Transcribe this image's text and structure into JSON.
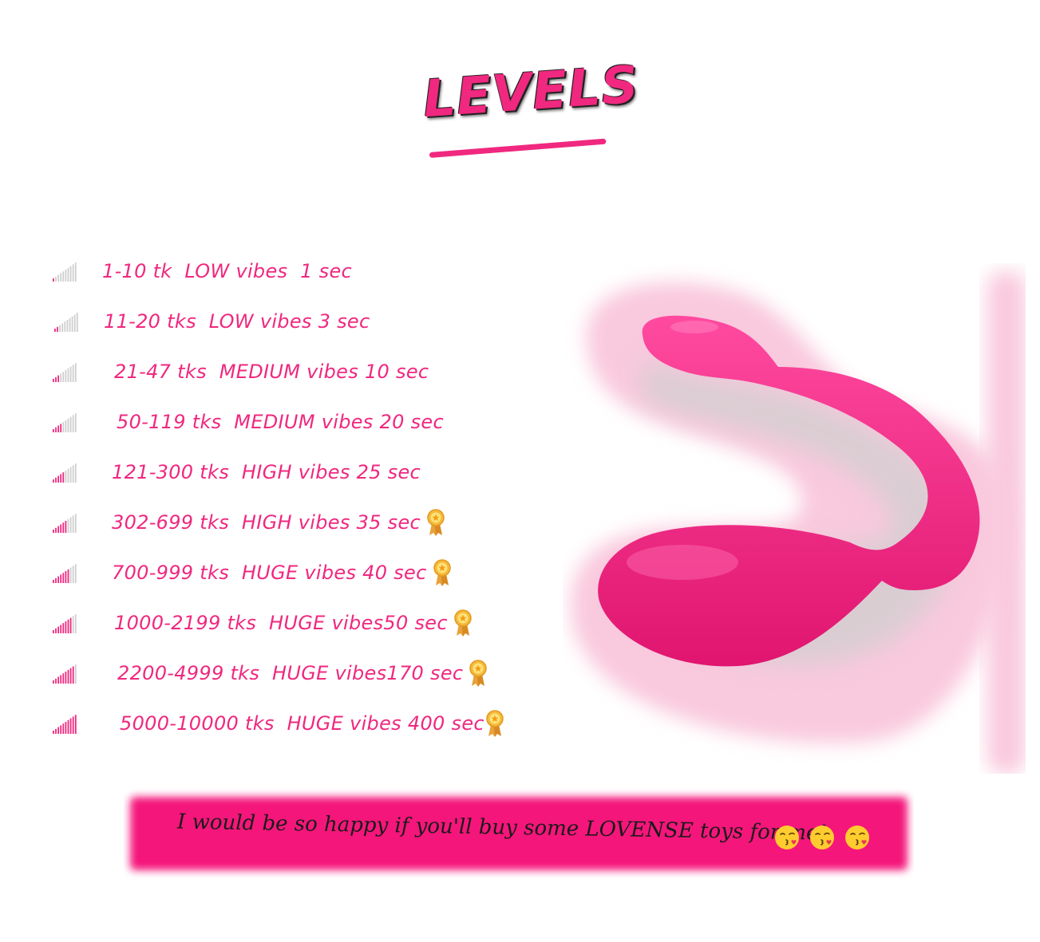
{
  "header": {
    "title": "LEVELS"
  },
  "levels": [
    {
      "text": "1-10 tk  LOW vibes  1 sec",
      "strength": 0.1,
      "medal": false
    },
    {
      "text": "11-20 tks  LOW vibes 3 sec",
      "strength": 0.2,
      "medal": false
    },
    {
      "text": "21-47 tks  MEDIUM vibes 10 sec",
      "strength": 0.3,
      "medal": false
    },
    {
      "text": "50-119 tks  MEDIUM vibes 20 sec",
      "strength": 0.4,
      "medal": false
    },
    {
      "text": "121-300 tks  HIGH vibes 25 sec",
      "strength": 0.5,
      "medal": false
    },
    {
      "text": "302-699 tks  HIGH vibes 35 sec",
      "strength": 0.6,
      "medal": true
    },
    {
      "text": "700-999 tks  HUGE vibes 40 sec",
      "strength": 0.7,
      "medal": true
    },
    {
      "text": "1000-2199 tks  HUGE vibes50 sec",
      "strength": 0.8,
      "medal": true
    },
    {
      "text": "2200-4999 tks  HUGE vibes170 sec",
      "strength": 0.9,
      "medal": true
    },
    {
      "text": "5000-10000 tks  HUGE vibes 400 sec",
      "strength": 1.0,
      "medal": true
    }
  ],
  "banner": {
    "text": "I would be so happy if you'll buy some LOVENSE toys for me!"
  },
  "emojis": [
    "kissing-face-icon",
    "kissing-face-icon",
    "kissing-face-icon"
  ],
  "colors": {
    "accent": "#f0287f",
    "bar_inactive": "#cfcfcf",
    "toy": "#ee1f7f",
    "glow": "#f9c9dd"
  }
}
